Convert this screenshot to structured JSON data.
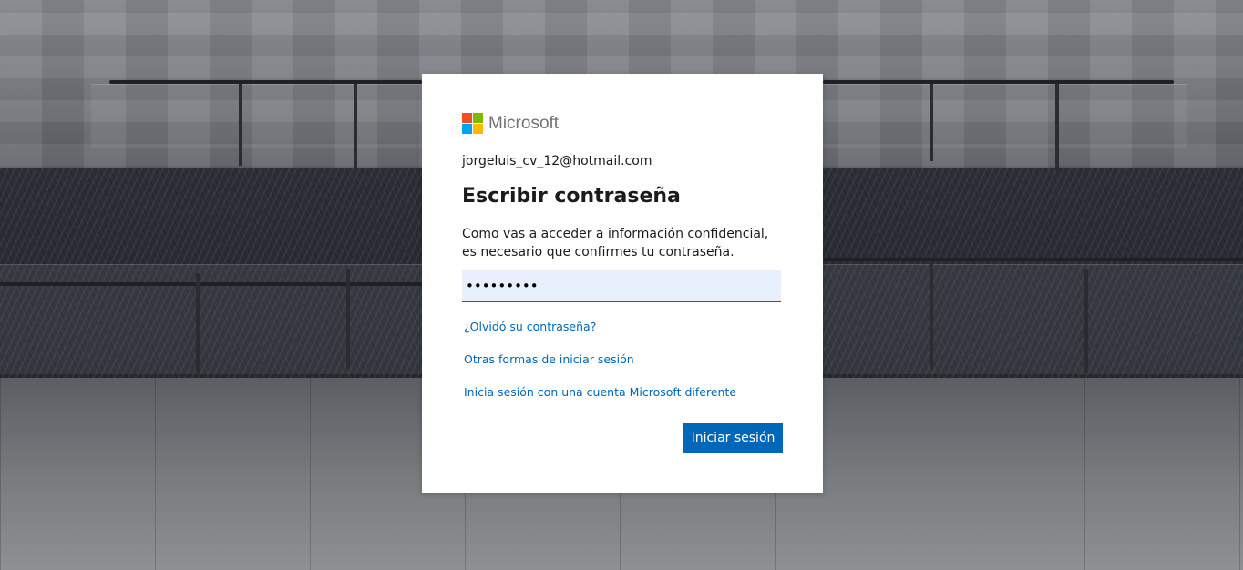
{
  "brand": {
    "name": "Microsoft",
    "colors": {
      "red": "#f25022",
      "green": "#7fba00",
      "blue": "#00a4ef",
      "yellow": "#ffb900"
    }
  },
  "signin": {
    "identity": "jorgeluis_cv_12@hotmail.com",
    "title": "Escribir contraseña",
    "description": "Como vas a acceder a información confidencial, es necesario que confirmes tu contraseña.",
    "password_value": "•••••••••",
    "forgot_link": "¿Olvidó su contraseña?",
    "other_ways_link": "Otras formas de iniciar sesión",
    "different_account_link": "Inicia sesión con una cuenta Microsoft diferente",
    "submit_label": "Iniciar sesión",
    "accent_color": "#0067b8"
  }
}
